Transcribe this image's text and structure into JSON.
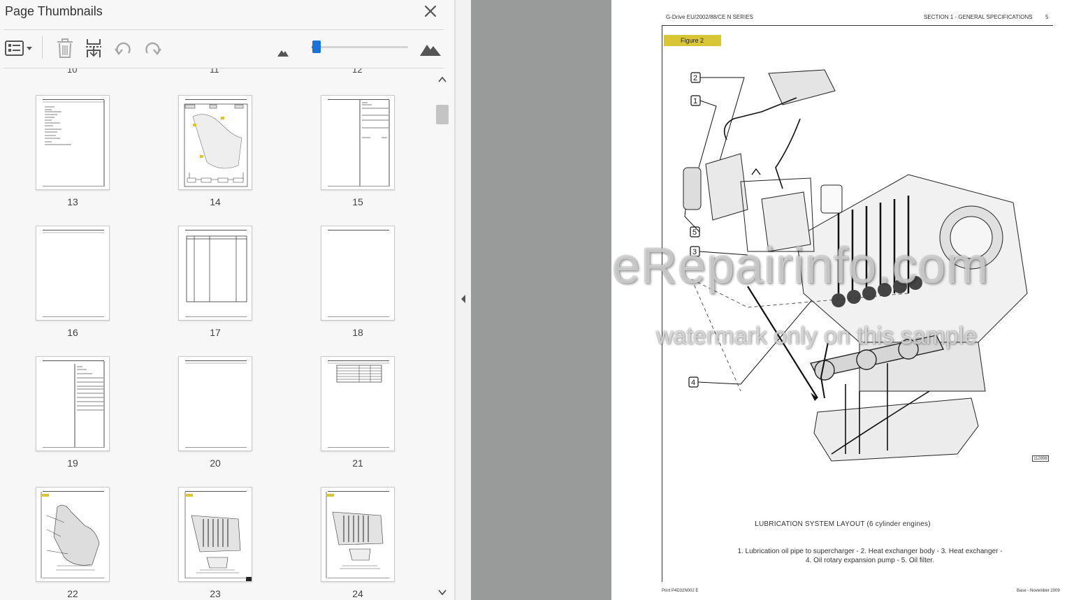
{
  "panel": {
    "title": "Page Thumbnails",
    "prev_row_numbers": [
      "10",
      "11",
      "12"
    ],
    "thumbnails": [
      {
        "number": "13"
      },
      {
        "number": "14"
      },
      {
        "number": "15"
      },
      {
        "number": "16"
      },
      {
        "number": "17"
      },
      {
        "number": "18"
      },
      {
        "number": "19"
      },
      {
        "number": "20"
      },
      {
        "number": "21"
      },
      {
        "number": "22"
      },
      {
        "number": "23"
      },
      {
        "number": "24"
      }
    ],
    "zoom_level": 0.05
  },
  "colors": {
    "accent": "#1a73d9",
    "gutter": "#999a9a",
    "figure_label": "#d9c636"
  },
  "icons": {
    "options": "list-options-icon",
    "delete": "trash-icon",
    "insert": "insert-page-icon",
    "undo": "undo-icon",
    "redo": "redo-icon",
    "zoom_out": "mountain-small-icon",
    "zoom_in": "mountain-large-icon",
    "close": "close-icon"
  },
  "document": {
    "header_left": "G-Drive EU/2002/88/CE N SERIES",
    "header_right": "SECTION 1 - GENERAL SPECIFICATIONS",
    "page_number": "5",
    "figure_label": "Figure 2",
    "callouts": [
      "2",
      "1",
      "5",
      "3",
      "4"
    ],
    "caption_title": "LUBRICATION SYSTEM LAYOUT (6 cylinder engines)",
    "caption_line1": "1. Lubrication oil pipe to supercharger - 2. Heat exchanger body - 3. Heat exchanger -",
    "caption_line2": "4. Oil rotary expansion pump - 5. Oil filter.",
    "figure_code": "112896",
    "footer_left": "Print P4D32N002 E",
    "footer_right": "Base - November 2009",
    "watermark_main": "eRepairinfo.com",
    "watermark_sub": "watermark only on this sample"
  }
}
